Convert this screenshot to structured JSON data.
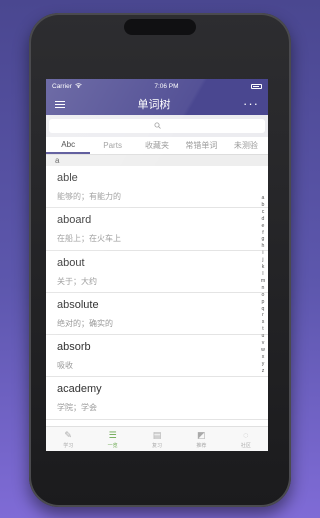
{
  "status_bar": {
    "carrier": "Carrier",
    "wifi_icon": "wifi-icon",
    "time": "7:06 PM",
    "battery_icon": "battery-icon"
  },
  "nav": {
    "title": "单词树",
    "menu_icon": "menu-icon",
    "more_icon": "more-icon"
  },
  "search": {
    "icon": "search-icon"
  },
  "tabs": [
    {
      "label": "Abc",
      "active": true
    },
    {
      "label": "Parts",
      "active": false
    },
    {
      "label": "收藏夹",
      "active": false
    },
    {
      "label": "常错单词",
      "active": false
    },
    {
      "label": "未测验",
      "active": false
    }
  ],
  "section_header": "a",
  "words": [
    {
      "word": "able",
      "meaning": "能够的；有能力的"
    },
    {
      "word": "aboard",
      "meaning": "在船上；在火车上"
    },
    {
      "word": "about",
      "meaning": "关于；大约"
    },
    {
      "word": "absolute",
      "meaning": "绝对的；确实的"
    },
    {
      "word": "absorb",
      "meaning": "吸收"
    },
    {
      "word": "academy",
      "meaning": "学院；学会"
    }
  ],
  "alphabet_index": [
    "a",
    "b",
    "c",
    "d",
    "e",
    "f",
    "g",
    "h",
    "i",
    "j",
    "k",
    "l",
    "m",
    "n",
    "o",
    "p",
    "q",
    "r",
    "s",
    "t",
    "u",
    "v",
    "w",
    "x",
    "y",
    "z"
  ],
  "tab_bar": [
    {
      "label": "学习",
      "icon": "pencil-icon",
      "active": false
    },
    {
      "label": "一览",
      "icon": "list-icon",
      "active": true
    },
    {
      "label": "复习",
      "icon": "book-icon",
      "active": false
    },
    {
      "label": "推荐",
      "icon": "thumb-icon",
      "active": false
    },
    {
      "label": "社区",
      "icon": "chat-icon",
      "active": false
    }
  ],
  "colors": {
    "accent": "#4a4790",
    "active_tab_bar": "#6aa84f"
  }
}
